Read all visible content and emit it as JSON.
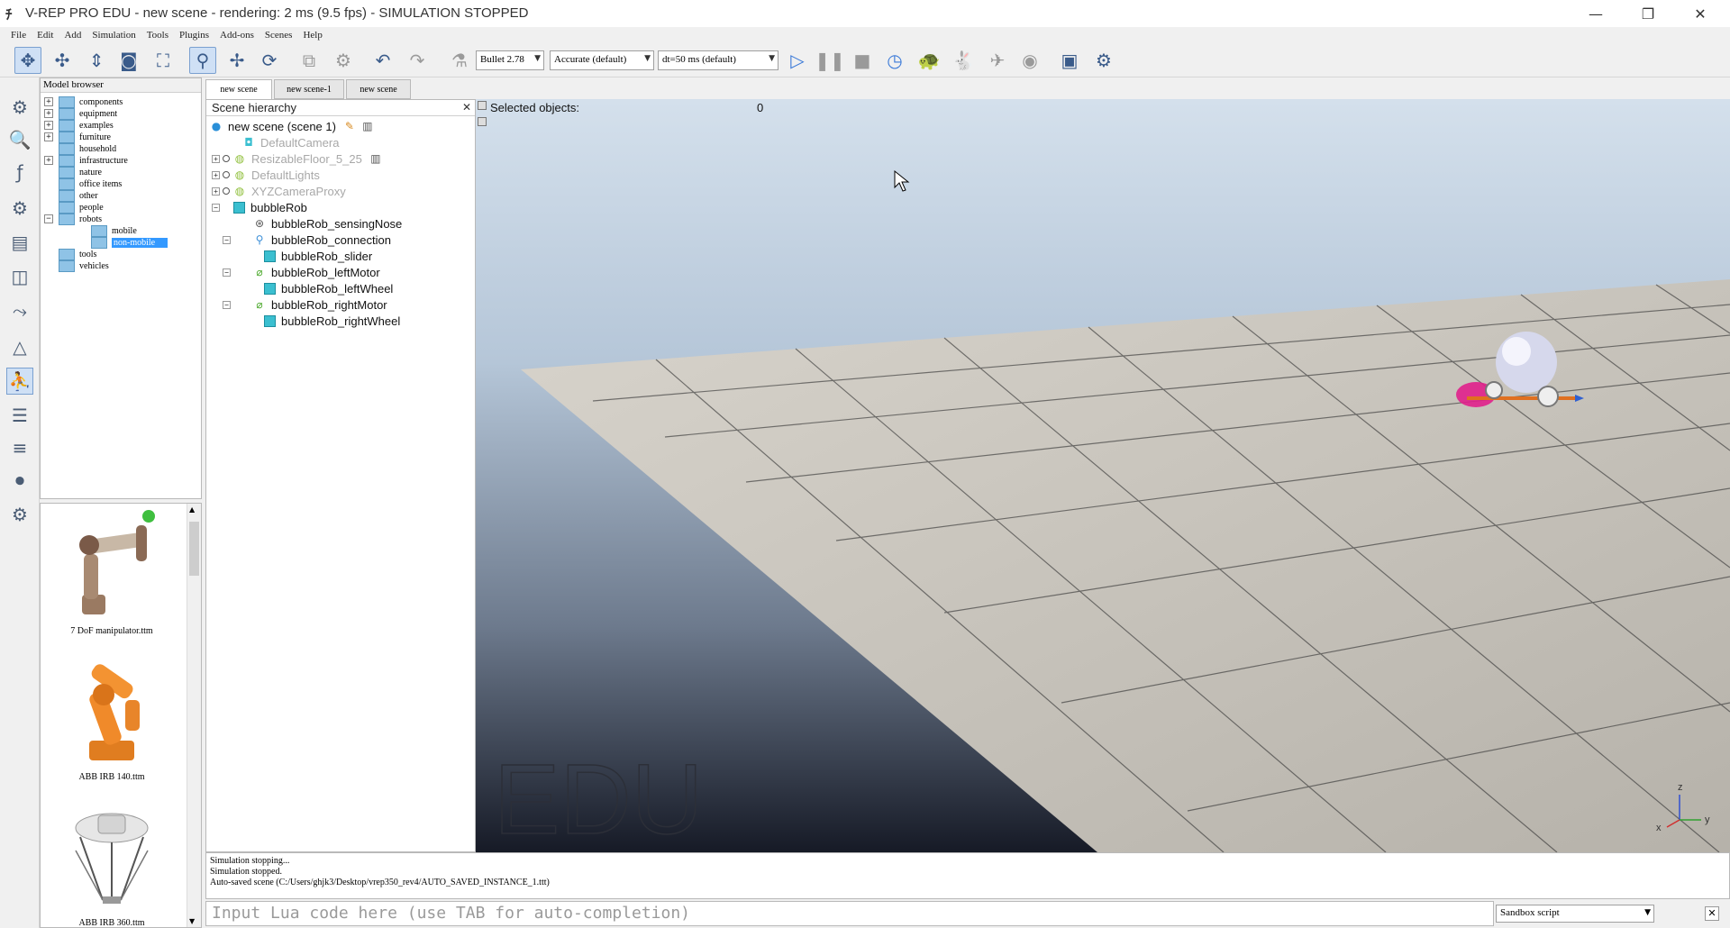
{
  "window": {
    "title": "V-REP PRO EDU - new scene - rendering: 2 ms (9.5 fps) - SIMULATION STOPPED",
    "minimize_glyph": "—",
    "restore_glyph": "❐",
    "close_glyph": "✕"
  },
  "menu": [
    "File",
    "Edit",
    "Add",
    "Simulation",
    "Tools",
    "Plugins",
    "Add-ons",
    "Scenes",
    "Help"
  ],
  "toolbar": {
    "engine": "Bullet 2.78",
    "accuracy": "Accurate (default)",
    "timestep": "dt=50 ms (default)",
    "dropdown_glyph": "▼"
  },
  "model_browser": {
    "title": "Model browser",
    "items": [
      {
        "label": "components",
        "exp": "+"
      },
      {
        "label": "equipment",
        "exp": "+"
      },
      {
        "label": "examples",
        "exp": "+"
      },
      {
        "label": "furniture",
        "exp": "+"
      },
      {
        "label": "household",
        "exp": ""
      },
      {
        "label": "infrastructure",
        "exp": "+"
      },
      {
        "label": "nature",
        "exp": ""
      },
      {
        "label": "office items",
        "exp": ""
      },
      {
        "label": "other",
        "exp": ""
      },
      {
        "label": "people",
        "exp": ""
      },
      {
        "label": "robots",
        "exp": "−"
      },
      {
        "label": "mobile",
        "exp": ""
      },
      {
        "label": "non-mobile",
        "exp": ""
      },
      {
        "label": "tools",
        "exp": ""
      },
      {
        "label": "vehicles",
        "exp": ""
      }
    ],
    "selected": "non-mobile"
  },
  "thumbnails": [
    {
      "label": "7 DoF manipulator.ttm"
    },
    {
      "label": "ABB IRB 140.ttm"
    },
    {
      "label": "ABB IRB 360.ttm"
    }
  ],
  "tabs": [
    "new scene",
    "new scene-1",
    "new scene"
  ],
  "hierarchy": {
    "title": "Scene hierarchy",
    "close_glyph": "✕",
    "root": "new scene (scene 1)",
    "items": [
      {
        "label": "DefaultCamera",
        "dim": true
      },
      {
        "label": "ResizableFloor_5_25",
        "dim": true
      },
      {
        "label": "DefaultLights",
        "dim": true
      },
      {
        "label": "XYZCameraProxy",
        "dim": true
      },
      {
        "label": "bubbleRob",
        "dim": false
      },
      {
        "label": "bubbleRob_sensingNose",
        "dim": false
      },
      {
        "label": "bubbleRob_connection",
        "dim": false
      },
      {
        "label": "bubbleRob_slider",
        "dim": false
      },
      {
        "label": "bubbleRob_leftMotor",
        "dim": false
      },
      {
        "label": "bubbleRob_leftWheel",
        "dim": false
      },
      {
        "label": "bubbleRob_rightMotor",
        "dim": false
      },
      {
        "label": "bubbleRob_rightWheel",
        "dim": false
      }
    ]
  },
  "viewport": {
    "selected_label": "Selected objects:",
    "selected_count": "0",
    "watermark": "EDU",
    "axis_z": "z",
    "axis_y": "y",
    "axis_x": "x"
  },
  "console": {
    "lines": [
      "Simulation stopping...",
      "Simulation stopped.",
      "Auto-saved scene (C:/Users/ghjk3/Desktop/vrep350_rev4/AUTO_SAVED_INSTANCE_1.ttt)"
    ]
  },
  "lua_input": {
    "placeholder": "Input Lua code here (use TAB for auto-completion)"
  },
  "script_selector": {
    "value": "Sandbox script",
    "close_glyph": "✕"
  }
}
